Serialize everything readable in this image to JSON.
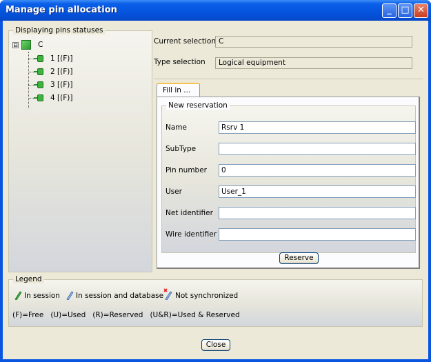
{
  "window": {
    "title": "Manage pin allocation",
    "controls": {
      "minimize": "_",
      "maximize": "□",
      "close": "✕"
    }
  },
  "tree_panel": {
    "label": "Displaying pins statuses",
    "root": {
      "label": "C",
      "expander": "⊟"
    },
    "pins": [
      {
        "label": "1 [(F)]"
      },
      {
        "label": "2 [(F)]"
      },
      {
        "label": "3 [(F)]"
      },
      {
        "label": "4 [(F)]"
      }
    ]
  },
  "selection": {
    "current_label": "Current selection",
    "current_value": "C",
    "type_label": "Type selection",
    "type_value": "Logical equipment"
  },
  "tabs": {
    "fill_in": "Fill in ..."
  },
  "reservation": {
    "group_label": "New reservation",
    "name_label": "Name",
    "name_value": "Rsrv 1",
    "subtype_label": "SubType",
    "subtype_value": "",
    "pin_number_label": "Pin number",
    "pin_number_value": "0",
    "user_label": "User",
    "user_value": "User_1",
    "net_identifier_label": "Net identifier",
    "net_identifier_value": "",
    "wire_identifier_label": "Wire identifier",
    "wire_identifier_value": "",
    "reserve_button": "Reserve"
  },
  "legend": {
    "label": "Legend",
    "in_session": "In session",
    "in_session_db": "In session and database",
    "not_synchronized": "Not synchronized",
    "codes": "(F)=Free   (U)=Used   (R)=Reserved   (U&R)=Used & Reserved"
  },
  "footer": {
    "close_button": "Close"
  },
  "colors": {
    "title_bar": "#0554de",
    "dialog_bg": "#ece9d8",
    "pin_green": "#3fb33f"
  }
}
